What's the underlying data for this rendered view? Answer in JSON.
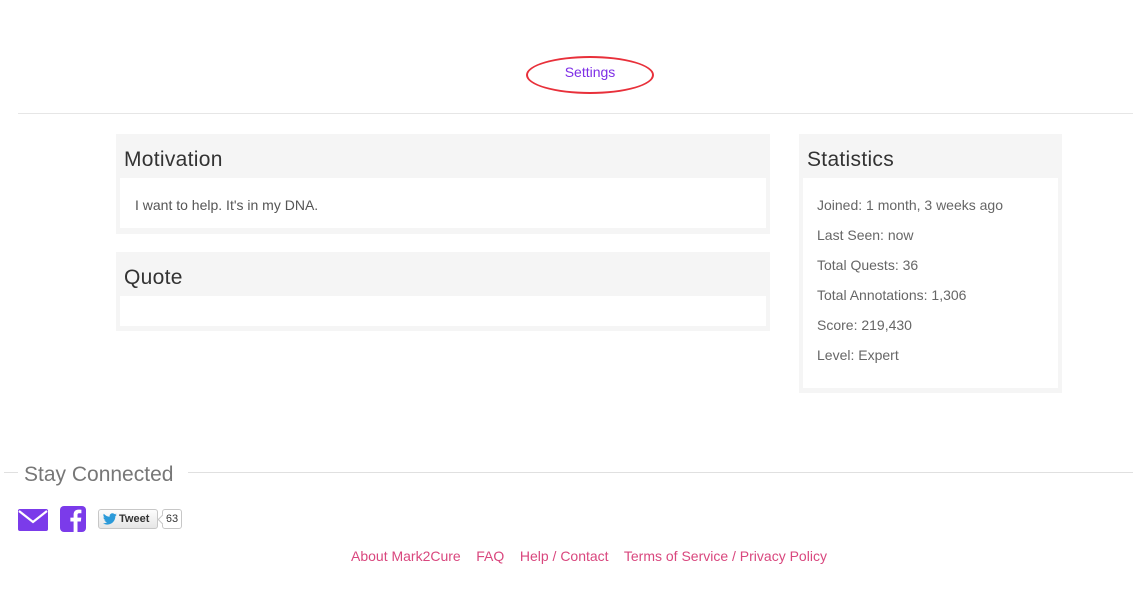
{
  "header": {
    "settings_label": "Settings"
  },
  "motivation": {
    "title": "Motivation",
    "text": "I want to help. It's in my DNA."
  },
  "quote": {
    "title": "Quote",
    "text": ""
  },
  "statistics": {
    "title": "Statistics",
    "lines": [
      "Joined: 1 month, 3 weeks ago",
      "Last Seen: now",
      "Total Quests: 36",
      "Total Annotations: 1,306",
      "Score: 219,430",
      "Level: Expert"
    ]
  },
  "stay_connected": {
    "title": "Stay Connected",
    "icons": [
      "mail-icon",
      "facebook-icon",
      "twitter-bird-icon"
    ],
    "tweet_label": "Tweet",
    "tweet_count": "63"
  },
  "footer": {
    "links": [
      "About Mark2Cure",
      "FAQ",
      "Help / Contact",
      "Terms of Service / Privacy Policy"
    ]
  },
  "colors": {
    "accent_purple": "#7e2ee6",
    "highlight_red": "#e8303a",
    "link_pink": "#d9477e",
    "social_purple": "#7b3bea"
  }
}
